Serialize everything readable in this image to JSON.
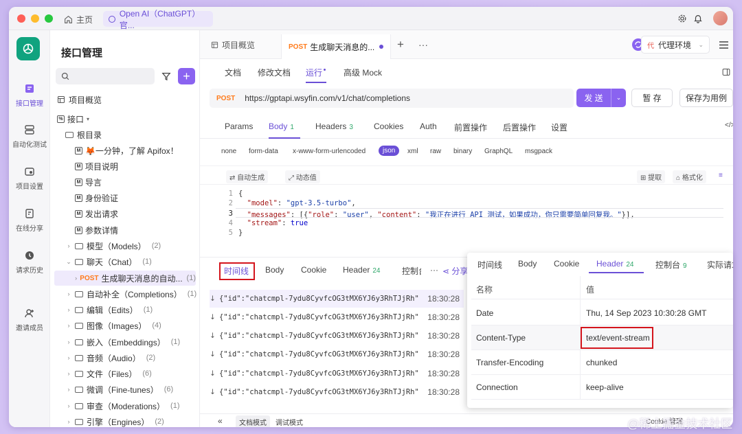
{
  "titlebar": {
    "home_label": "主页",
    "window_tab_label": "Open AI（ChatGPT）官..."
  },
  "leftnav": {
    "items": [
      {
        "label": "接口管理",
        "icon": "api-icon"
      },
      {
        "label": "自动化测试",
        "icon": "automation-icon"
      },
      {
        "label": "项目设置",
        "icon": "settings-icon"
      },
      {
        "label": "在线分享",
        "icon": "share-icon"
      },
      {
        "label": "请求历史",
        "icon": "history-icon"
      },
      {
        "label": "邀请成员",
        "icon": "invite-icon"
      }
    ]
  },
  "tree": {
    "title": "接口管理",
    "overview": "项目概览",
    "api_label": "接口",
    "root_label": "根目录",
    "docs": [
      "🦊一分钟，了解 Apifox！",
      "项目说明",
      "导言",
      "身份验证",
      "发出请求",
      "参数详情"
    ],
    "folders_a": [
      {
        "label": "模型（Models）",
        "count": "(2)"
      },
      {
        "label": "聊天（Chat）",
        "count": "(1)"
      }
    ],
    "selected": {
      "method": "POST",
      "label": "生成聊天消息的自动...",
      "count": "(1)"
    },
    "folders_b": [
      {
        "label": "自动补全（Completions）",
        "count": "(1)"
      },
      {
        "label": "编辑（Edits）",
        "count": "(1)"
      },
      {
        "label": "图像（Images）",
        "count": "(4)"
      },
      {
        "label": "嵌入（Embeddings）",
        "count": "(1)"
      },
      {
        "label": "音频（Audio）",
        "count": "(2)"
      },
      {
        "label": "文件（Files）",
        "count": "(6)"
      },
      {
        "label": "微调（Fine-tunes）",
        "count": "(6)"
      },
      {
        "label": "审查（Moderations）",
        "count": "(1)"
      },
      {
        "label": "引擎（Engines）",
        "count": "(2)"
      }
    ]
  },
  "main": {
    "tab_overview": "项目概览",
    "tab_active_method": "POST",
    "tab_active_label": "生成聊天消息的...",
    "env_badge": "代",
    "env_label": "代理环境",
    "subtabs": [
      "文档",
      "修改文档",
      "运行",
      "高级 Mock"
    ],
    "method": "POST",
    "url": "https://gptapi.wsyfin.com/v1/chat/completions",
    "send_label": "发 送",
    "save_label": "暂 存",
    "save_case_label": "保存为用例",
    "req_tabs": [
      {
        "label": "Params",
        "badge": ""
      },
      {
        "label": "Body",
        "badge": "1"
      },
      {
        "label": "Headers",
        "badge": "3"
      },
      {
        "label": "Cookies",
        "badge": ""
      },
      {
        "label": "Auth",
        "badge": ""
      },
      {
        "label": "前置操作",
        "badge": ""
      },
      {
        "label": "后置操作",
        "badge": ""
      },
      {
        "label": "设置",
        "badge": ""
      }
    ],
    "body_types": [
      "none",
      "form-data",
      "x-www-form-urlencoded",
      "json",
      "xml",
      "raw",
      "binary",
      "GraphQL",
      "msgpack"
    ],
    "auto_gen": "自动生成",
    "dynamic_val": "动态值",
    "extract": "提取",
    "format": "格式化",
    "code_lines": [
      "1",
      "2",
      "3",
      "4",
      "5"
    ]
  },
  "response": {
    "tabs": [
      {
        "label": "时间线",
        "badge": ""
      },
      {
        "label": "Body",
        "badge": ""
      },
      {
        "label": "Cookie",
        "badge": ""
      },
      {
        "label": "Header",
        "badge": "24"
      },
      {
        "label": "控制台",
        "badge": ""
      }
    ],
    "share_label": "分享",
    "rows": [
      {
        "text": "{\"id\":\"chatcmpl-7ydu8CyvfcOG3tMX6YJ6y3RhTJjRh\",...",
        "time": "18:30:28"
      },
      {
        "text": "{\"id\":\"chatcmpl-7ydu8CyvfcOG3tMX6YJ6y3RhTJjRh\",...",
        "time": "18:30:28"
      },
      {
        "text": "{\"id\":\"chatcmpl-7ydu8CyvfcOG3tMX6YJ6y3RhTJjRh\",...",
        "time": "18:30:28"
      },
      {
        "text": "{\"id\":\"chatcmpl-7ydu8CyvfcOG3tMX6YJ6y3RhTJjRh\",...",
        "time": "18:30:28"
      },
      {
        "text": "{\"id\":\"chatcmpl-7ydu8CyvfcOG3tMX6YJ6y3RhTJjRh\",...",
        "time": "18:30:28"
      },
      {
        "text": "{\"id\":\"chatcmpl-7ydu8CyvfcOG3tMX6YJ6y3RhTJjRh\",...",
        "time": "18:30:28"
      }
    ],
    "footer_doc": "文档模式",
    "footer_debug": "调试模式",
    "footer_cookie": "Cookie 管理"
  },
  "popup": {
    "tabs": [
      {
        "label": "时间线",
        "badge": ""
      },
      {
        "label": "Body",
        "badge": ""
      },
      {
        "label": "Cookie",
        "badge": ""
      },
      {
        "label": "Header",
        "badge": "24"
      },
      {
        "label": "控制台",
        "badge": "9"
      },
      {
        "label": "实际请求",
        "badge": ""
      }
    ],
    "col_name": "名称",
    "col_value": "值",
    "rows": [
      {
        "name": "Date",
        "value": "Thu, 14 Sep 2023 10:30:28 GMT"
      },
      {
        "name": "Content-Type",
        "value": "text/event-stream"
      },
      {
        "name": "Transfer-Encoding",
        "value": "chunked"
      },
      {
        "name": "Connection",
        "value": "keep-alive"
      }
    ]
  },
  "watermark": "@稀土掘金技术社区",
  "colors": {
    "accent": "#8a63f0",
    "method_post": "#ff7a1a",
    "highlight_box": "#d4141c",
    "badge_green": "#2fa76a"
  }
}
